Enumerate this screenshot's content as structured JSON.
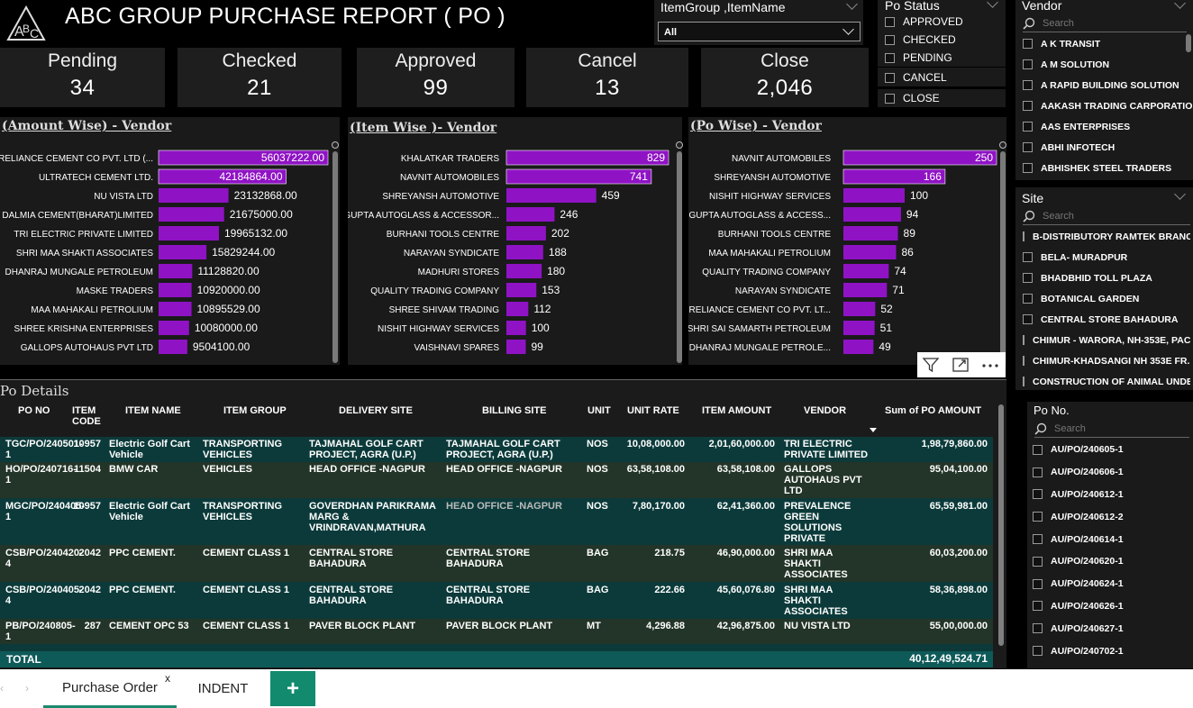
{
  "header": {
    "title": "ABC GROUP PURCHASE REPORT ( PO )"
  },
  "kpis": [
    {
      "label": "Pending",
      "value": "34"
    },
    {
      "label": "Checked",
      "value": "21"
    },
    {
      "label": "Approved",
      "value": "99"
    },
    {
      "label": "Cancel",
      "value": "13"
    },
    {
      "label": "Close",
      "value": "2,046"
    }
  ],
  "item_group_slicer": {
    "title": "ItemGroup ,ItemName",
    "value": "All"
  },
  "po_status_slicer": {
    "title": "Po Status",
    "options": [
      "APPROVED",
      "CHECKED",
      "PENDING",
      "CANCEL",
      "CLOSE"
    ]
  },
  "vendor_slicer": {
    "title": "Vendor",
    "search_placeholder": "Search",
    "items": [
      "A K TRANSIT",
      "A M SOLUTION",
      "A RAPID BUILDING SOLUTION",
      "AAKASH TRADING CARPORATION",
      "AAS ENTERPRISES",
      "ABHI INFOTECH",
      "ABHISHEK STEEL TRADERS"
    ]
  },
  "site_slicer": {
    "title": "Site",
    "search_placeholder": "Search",
    "items": [
      "B-DISTRIBUTORY RAMTEK BRANC...",
      "BELA- MURADPUR",
      "BHADBHID TOLL PLAZA",
      "BOTANICAL GARDEN",
      "CENTRAL STORE BAHADURA",
      "CHIMUR - WARORA, NH-353E, PAC...",
      "CHIMUR-KHADSANGI NH 353E FR...",
      "CONSTRUCTION OF ANIMAL UNDE..."
    ]
  },
  "pono_slicer": {
    "title": "Po No.",
    "search_placeholder": "Search",
    "items": [
      "AU/PO/240605-1",
      "AU/PO/240606-1",
      "AU/PO/240612-1",
      "AU/PO/240612-2",
      "AU/PO/240614-1",
      "AU/PO/240620-1",
      "AU/PO/240624-1",
      "AU/PO/240626-1",
      "AU/PO/240627-1",
      "AU/PO/240702-1"
    ]
  },
  "chart_data": [
    {
      "type": "bar",
      "orientation": "horizontal",
      "title": "(Amount Wise) - Vendor",
      "categories": [
        "RELIANCE CEMENT CO PVT. LTD (...",
        "ULTRATECH CEMENT LTD.",
        "NU VISTA LTD",
        "DALMIA CEMENT(BHARAT)LIMITED",
        "TRI ELECTRIC PRIVATE LIMITED",
        "SHRI MAA SHAKTI ASSOCIATES",
        "DHANRAJ MUNGALE PETROLEUM",
        "MASKE TRADERS",
        "MAA MAHAKALI PETROLIUM",
        "SHREE KRISHNA ENTERPRISES",
        "GALLOPS AUTOHAUS PVT LTD"
      ],
      "values": [
        56037222.0,
        42184864.0,
        23132868.0,
        21675000.0,
        19965132.0,
        15829244.0,
        11128820.0,
        10920000.0,
        10895529.0,
        10080000.0,
        9504100.0
      ],
      "labels": [
        "56037222.00",
        "42184864.00",
        "23132868.00",
        "21675000.00",
        "19965132.00",
        "15829244.00",
        "11128820.00",
        "10920000.00",
        "10895529.00",
        "10080000.00",
        "9504100.00"
      ],
      "color": "#8f13c4"
    },
    {
      "type": "bar",
      "orientation": "horizontal",
      "title": "(Item Wise )- Vendor",
      "categories": [
        "KHALATKAR TRADERS",
        "NAVNIT AUTOMOBILES",
        "SHREYANSH AUTOMOTIVE",
        "GUPTA AUTOGLASS & ACCESSOR...",
        "BURHANI TOOLS CENTRE",
        "NARAYAN SYNDICATE",
        "MADHURI STORES",
        "QUALITY TRADING COMPANY",
        "SHREE SHIVAM TRADING",
        "NISHIT HIGHWAY SERVICES",
        "VAISHNAVI SPARES"
      ],
      "values": [
        829,
        741,
        459,
        246,
        202,
        188,
        180,
        153,
        112,
        100,
        99
      ],
      "labels": [
        "829",
        "741",
        "459",
        "246",
        "202",
        "188",
        "180",
        "153",
        "112",
        "100",
        "99"
      ],
      "color": "#8f13c4"
    },
    {
      "type": "bar",
      "orientation": "horizontal",
      "title": "(Po Wise) - Vendor",
      "categories": [
        "NAVNIT AUTOMOBILES",
        "SHREYANSH AUTOMOTIVE",
        "NISHIT HIGHWAY SERVICES",
        "GUPTA AUTOGLASS & ACCESS...",
        "BURHANI TOOLS CENTRE",
        "MAA MAHAKALI PETROLIUM",
        "QUALITY TRADING COMPANY",
        "NARAYAN SYNDICATE",
        "RELIANCE CEMENT CO PVT. LT...",
        "SHRI SAI SAMARTH PETROLEUM",
        "DHANRAJ MUNGALE PETROLE..."
      ],
      "values": [
        250,
        166,
        100,
        94,
        89,
        86,
        74,
        71,
        52,
        51,
        49
      ],
      "labels": [
        "250",
        "166",
        "100",
        "94",
        "89",
        "86",
        "74",
        "71",
        "52",
        "51",
        "49"
      ],
      "color": "#8f13c4"
    }
  ],
  "po_details": {
    "title": "Po Details",
    "columns": [
      "PO NO",
      "ITEM CODE",
      "ITEM NAME",
      "ITEM GROUP",
      "DELIVERY SITE",
      "BILLING SITE",
      "UNIT",
      "UNIT RATE",
      "ITEM AMOUNT",
      "VENDOR",
      "Sum of PO AMOUNT"
    ],
    "rows": [
      [
        "TGC/PO/240501-1",
        "10957",
        "Electric Golf Cart Vehicle",
        "TRANSPORTING VEHICLES",
        "TAJMAHAL GOLF CART PROJECT, AGRA (U.P.)",
        "TAJMAHAL GOLF CART PROJECT, AGRA (U.P.)",
        "NOS",
        "10,08,000.00",
        "2,01,60,000.00",
        "TRI ELECTRIC PRIVATE LIMITED",
        "1,98,79,860.00"
      ],
      [
        "HO/PO/240716-1",
        "11504",
        "BMW CAR",
        "VEHICLES",
        "HEAD OFFICE -NAGPUR",
        "HEAD OFFICE -NAGPUR",
        "NOS",
        "63,58,108.00",
        "63,58,108.00",
        "GALLOPS AUTOHAUS PVT LTD",
        "95,04,100.00"
      ],
      [
        "MGC/PO/240405-1",
        "10957",
        "Electric Golf Cart Vehicle",
        "TRANSPORTING VEHICLES",
        "GOVERDHAN PARIKRAMA MARG & VRINDRAVAN,MATHURA",
        "HEAD OFFICE -NAGPUR",
        "NOS",
        "7,80,170.00",
        "62,41,360.00",
        "PREVALENCE GREEN SOLUTIONS PRIVATE LIMITED",
        "65,59,981.00"
      ],
      [
        "CSB/PO/240420-4",
        "2042",
        "PPC CEMENT.",
        "CEMENT CLASS 1",
        "CENTRAL STORE BAHADURA",
        "CENTRAL STORE BAHADURA",
        "BAG",
        "218.75",
        "46,90,000.00",
        "SHRI MAA SHAKTI ASSOCIATES",
        "60,03,200.00"
      ],
      [
        "CSB/PO/240405-4",
        "2042",
        "PPC CEMENT.",
        "CEMENT CLASS 1",
        "CENTRAL STORE BAHADURA",
        "CENTRAL STORE BAHADURA",
        "BAG",
        "222.66",
        "45,60,076.80",
        "SHRI MAA SHAKTI ASSOCIATES",
        "58,36,898.00"
      ],
      [
        "PB/PO/240805-1",
        "287",
        "CEMENT OPC 53",
        "CEMENT CLASS 1",
        "PAVER BLOCK PLANT",
        "PAVER BLOCK PLANT",
        "MT",
        "4,296.88",
        "42,96,875.00",
        "NU VISTA LTD",
        "55,00,000.00"
      ]
    ],
    "total_label": "TOTAL",
    "total_value": "40,12,49,524.71"
  },
  "tabs": {
    "active": "Purchase Order",
    "second": "INDENT",
    "close": "x",
    "add": "+"
  },
  "colors": {
    "bar": "#8f13c4",
    "row_dark": "#0c3a3a",
    "row_alt": "#233428",
    "total_row": "#0e5a59",
    "add_tab": "#118a6e"
  }
}
